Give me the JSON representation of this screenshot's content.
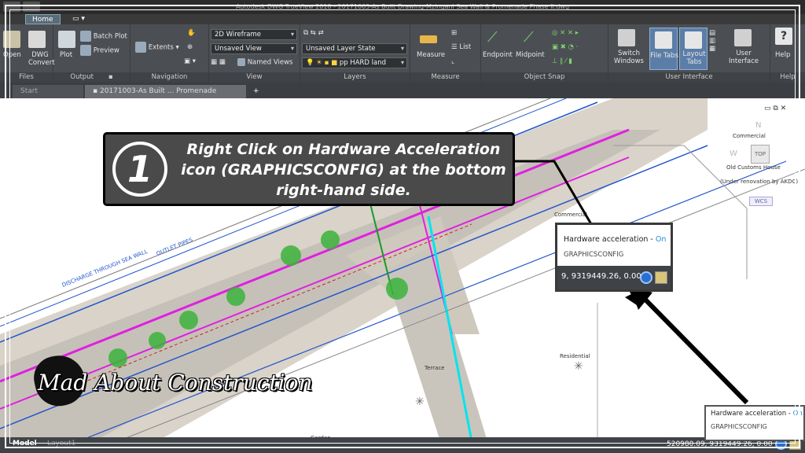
{
  "window": {
    "title": "Autodesk DWG TrueView 2018 - 20171003-As Built Drawing-Mzingani Sea Wall & Promenade Phase II.dwg"
  },
  "ribbon": {
    "active_tab": "Home",
    "panels": {
      "files": {
        "title": "Files",
        "open": "Open",
        "dwg_convert": "DWG Convert"
      },
      "output": {
        "title": "Output",
        "plot": "Plot",
        "batch_plot": "Batch Plot",
        "preview": "Preview"
      },
      "navigation": {
        "title": "Navigation",
        "extents": "Extents"
      },
      "view": {
        "title": "View",
        "visual_style": "2D Wireframe",
        "saved_view": "Unsaved View",
        "named_views": "Named Views"
      },
      "layers": {
        "title": "Layers",
        "layer_state": "Unsaved Layer State",
        "current_layer": "pp HARD land"
      },
      "measure": {
        "title": "Measure",
        "measure": "Measure",
        "list": "List"
      },
      "object_snap": {
        "title": "Object Snap",
        "endpoint": "Endpoint",
        "midpoint": "Midpoint"
      },
      "user_interface": {
        "title": "User Interface",
        "switch_windows": "Switch Windows",
        "file_tabs": "File Tabs",
        "layout_tabs": "Layout Tabs",
        "user_interface": "User Interface",
        "help": "Help"
      },
      "help_title": "Help"
    }
  },
  "doc_tabs": {
    "start": "Start",
    "file": "20171003-As Built ... Promenade Phase II",
    "add": "+"
  },
  "drawing_labels": {
    "discharge": "DISCHARGE THROUGH SEA WALL",
    "outlet": "OUTLET PIPES",
    "commercial1": "Commercial",
    "commercial2": "Commercial",
    "old_customs": "Old Customs House",
    "under_renovation": "(Under renovation by AKDC)",
    "residential": "Residential",
    "terrace": "Terrace",
    "garden": "Garden",
    "compass_n": "N",
    "compass_w": "W",
    "cube_top": "TOP",
    "wcs": "WCS"
  },
  "callout": {
    "number": "1",
    "text": "Right Click on Hardware Acceleration icon (GRAPHICSCONFIG) at the bottom right-hand side."
  },
  "tooltip": {
    "title": "Hardware acceleration - ",
    "state": "On",
    "command": "GRAPHICSCONFIG",
    "coord_partial": "9, 9319449.26, 0.00"
  },
  "statusbar": {
    "model_tab": "Model",
    "layout_tab": "Layout1",
    "coordinates": "520980.09, 9319449.26, 0.00"
  },
  "watermark": {
    "text": "Mad About Construction"
  },
  "colors": {
    "accent": "#1e8fd6",
    "ribbon_bg": "#4b4f54",
    "callout_bg": "#4a4a4a",
    "magenta_line": "#e020e0",
    "cyan_line": "#00e5ee",
    "blue_line": "#2255cc",
    "paving": "#d8d2c8"
  }
}
